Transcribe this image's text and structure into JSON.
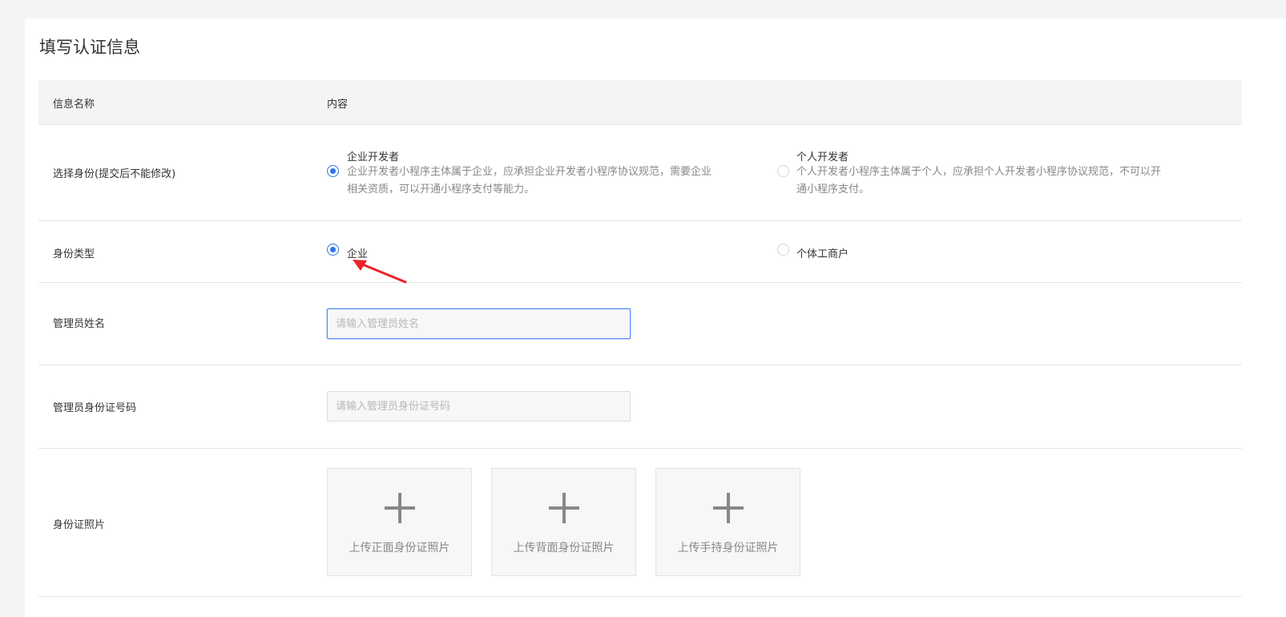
{
  "page": {
    "title": "填写认证信息"
  },
  "table": {
    "header": {
      "col_name": "信息名称",
      "col_content": "内容"
    }
  },
  "identity": {
    "label": "选择身份(提交后不能修改)",
    "options": [
      {
        "title": "企业开发者",
        "desc_line1": "企业开发者小程序主体属于企业，应承担企业开发者小程序协议规范，需要企业",
        "desc_line2": "相关资质，可以开通小程序支付等能力。",
        "selected": true
      },
      {
        "title": "个人开发者",
        "desc_line1": "个人开发者小程序主体属于个人，应承担个人开发者小程序协议规范，不可以开",
        "desc_line2": "通小程序支付。",
        "selected": false
      }
    ]
  },
  "identity_type": {
    "label": "身份类型",
    "options": [
      {
        "text": "企业",
        "selected": true
      },
      {
        "text": "个体工商户",
        "selected": false
      }
    ]
  },
  "admin_name": {
    "label": "管理员姓名",
    "value": "",
    "placeholder": "请输入管理员姓名"
  },
  "admin_id": {
    "label": "管理员身份证号码",
    "value": "",
    "placeholder": "请输入管理员身份证号码"
  },
  "id_photos": {
    "label": "身份证照片",
    "uploads": [
      {
        "text": "上传正面身份证照片"
      },
      {
        "text": "上传背面身份证照片"
      },
      {
        "text": "上传手持身份证照片"
      }
    ]
  },
  "colors": {
    "accent": "#2e73e8",
    "annotation_arrow": "#e8242a",
    "header_bg": "#f3f4f6"
  }
}
